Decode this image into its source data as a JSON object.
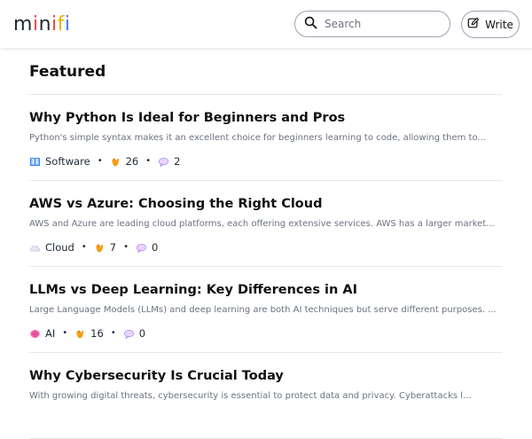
{
  "header": {
    "logo": {
      "m": "m",
      "i1": "i",
      "n": "n",
      "i2": "i",
      "f": "f",
      "i3": "i"
    },
    "search_placeholder": "Search",
    "write_label": "Write"
  },
  "main": {
    "section_title": "Featured",
    "posts": [
      {
        "title": "Why Python Is Ideal for Beginners and Pros",
        "excerpt": "Python's simple syntax makes it an excellent choice for beginners learning to code, allowing them to...",
        "category": "Software",
        "category_icon": "book-icon",
        "likes": "26",
        "comments": "2"
      },
      {
        "title": "AWS vs Azure: Choosing the Right Cloud",
        "excerpt": "AWS and Azure are leading cloud platforms, each offering extensive services. AWS has a larger market...",
        "category": "Cloud",
        "category_icon": "cloud-icon",
        "likes": "7",
        "comments": "0"
      },
      {
        "title": "LLMs vs Deep Learning: Key Differences in AI",
        "excerpt": "Large Language Models (LLMs) and deep learning are both AI techniques but serve different purposes. ...",
        "category": "AI",
        "category_icon": "brain-icon",
        "likes": "16",
        "comments": "0"
      },
      {
        "title": "Why Cybersecurity Is Crucial Today",
        "excerpt": "With growing digital threats, cybersecurity is essential to protect data and privacy. Cyberattacks l...",
        "category": "",
        "category_icon": "",
        "likes": "",
        "comments": ""
      }
    ],
    "dot_separator": "•"
  },
  "colors": {
    "accent_logo_red": "#ef4444",
    "accent_logo_yellow": "#eab308",
    "accent_logo_blue": "#3b82f6",
    "excerpt_gray": "#6b7280",
    "divider": "#e5e7eb"
  }
}
